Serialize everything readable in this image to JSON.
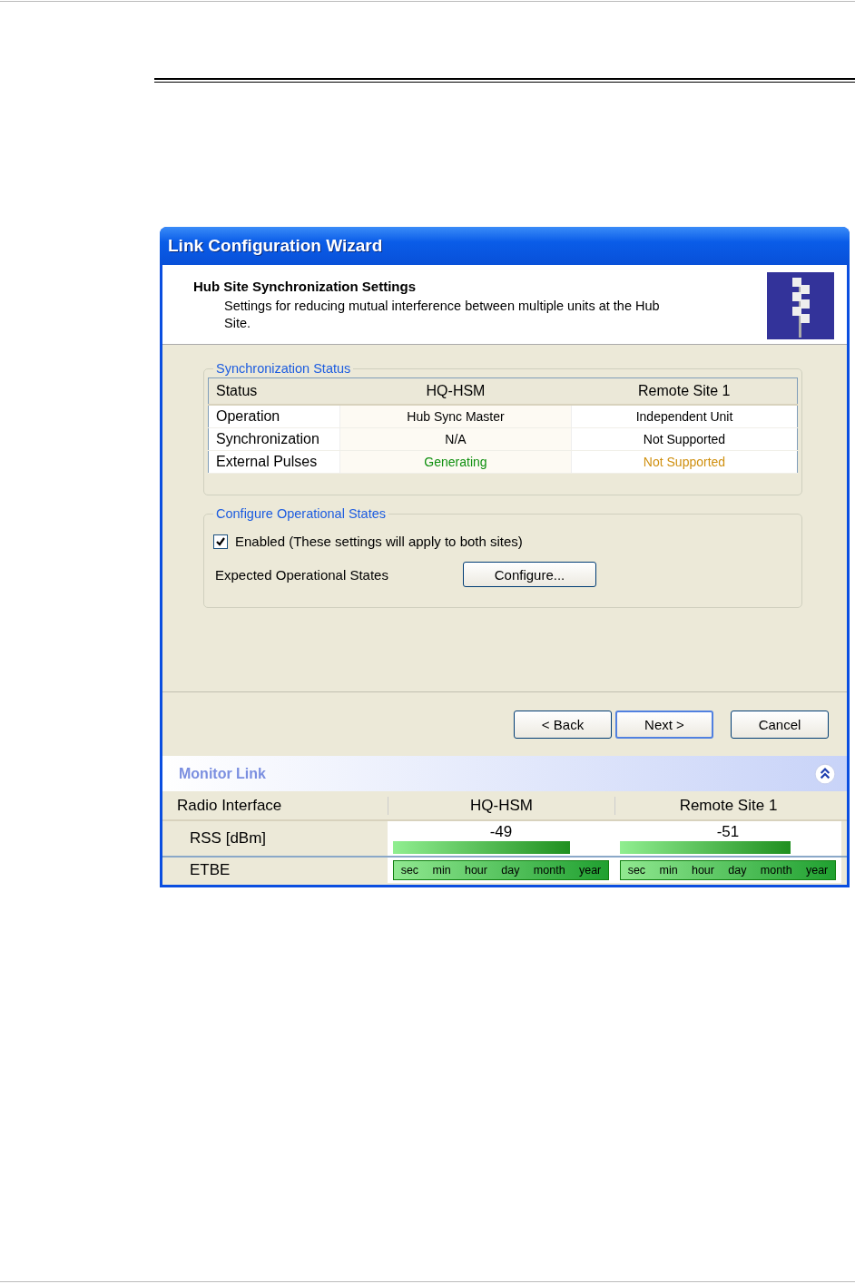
{
  "window": {
    "title": "Link Configuration Wizard"
  },
  "header": {
    "title": "Hub Site Synchronization Settings",
    "description": "Settings for reducing mutual interference between multiple units at the Hub Site."
  },
  "sync_status": {
    "legend": "Synchronization Status",
    "columns": [
      "Status",
      "HQ-HSM",
      "Remote Site 1"
    ],
    "rows": [
      {
        "cells": [
          {
            "text": "Operation",
            "color": "#000000"
          },
          {
            "text": "Hub Sync Master",
            "color": "#000000"
          },
          {
            "text": "Independent Unit",
            "color": "#000000"
          }
        ]
      },
      {
        "cells": [
          {
            "text": "Synchronization",
            "color": "#000000"
          },
          {
            "text": "N/A",
            "color": "#000000"
          },
          {
            "text": "Not Supported",
            "color": "#000000"
          }
        ]
      },
      {
        "cells": [
          {
            "text": "External Pulses",
            "color": "#000000"
          },
          {
            "text": "Generating",
            "color": "#109010"
          },
          {
            "text": "Not Supported",
            "color": "#d09010"
          }
        ]
      }
    ]
  },
  "operational_states": {
    "legend": "Configure Operational States",
    "checkbox": {
      "label": "Enabled (These settings will apply to both sites)",
      "checked": true
    },
    "expected_label": "Expected Operational States",
    "button": "Configure..."
  },
  "buttons": [
    {
      "label": "< Back",
      "default": false
    },
    {
      "label": "Next >",
      "default": true
    },
    {
      "label": "Cancel",
      "default": false
    }
  ],
  "monitor": {
    "title": "Monitor Link",
    "columns": [
      "Radio Interface",
      "HQ-HSM",
      "Remote Site 1"
    ],
    "rss": {
      "label": "RSS [dBm]",
      "values": [
        {
          "text": "-49",
          "level": 0.82
        },
        {
          "text": "-51",
          "level": 0.79
        }
      ]
    },
    "etbe": {
      "label": "ETBE",
      "scales": [
        [
          "sec",
          "min",
          "hour",
          "day",
          "month",
          "year"
        ],
        [
          "sec",
          "min",
          "hour",
          "day",
          "month",
          "year"
        ]
      ]
    }
  }
}
